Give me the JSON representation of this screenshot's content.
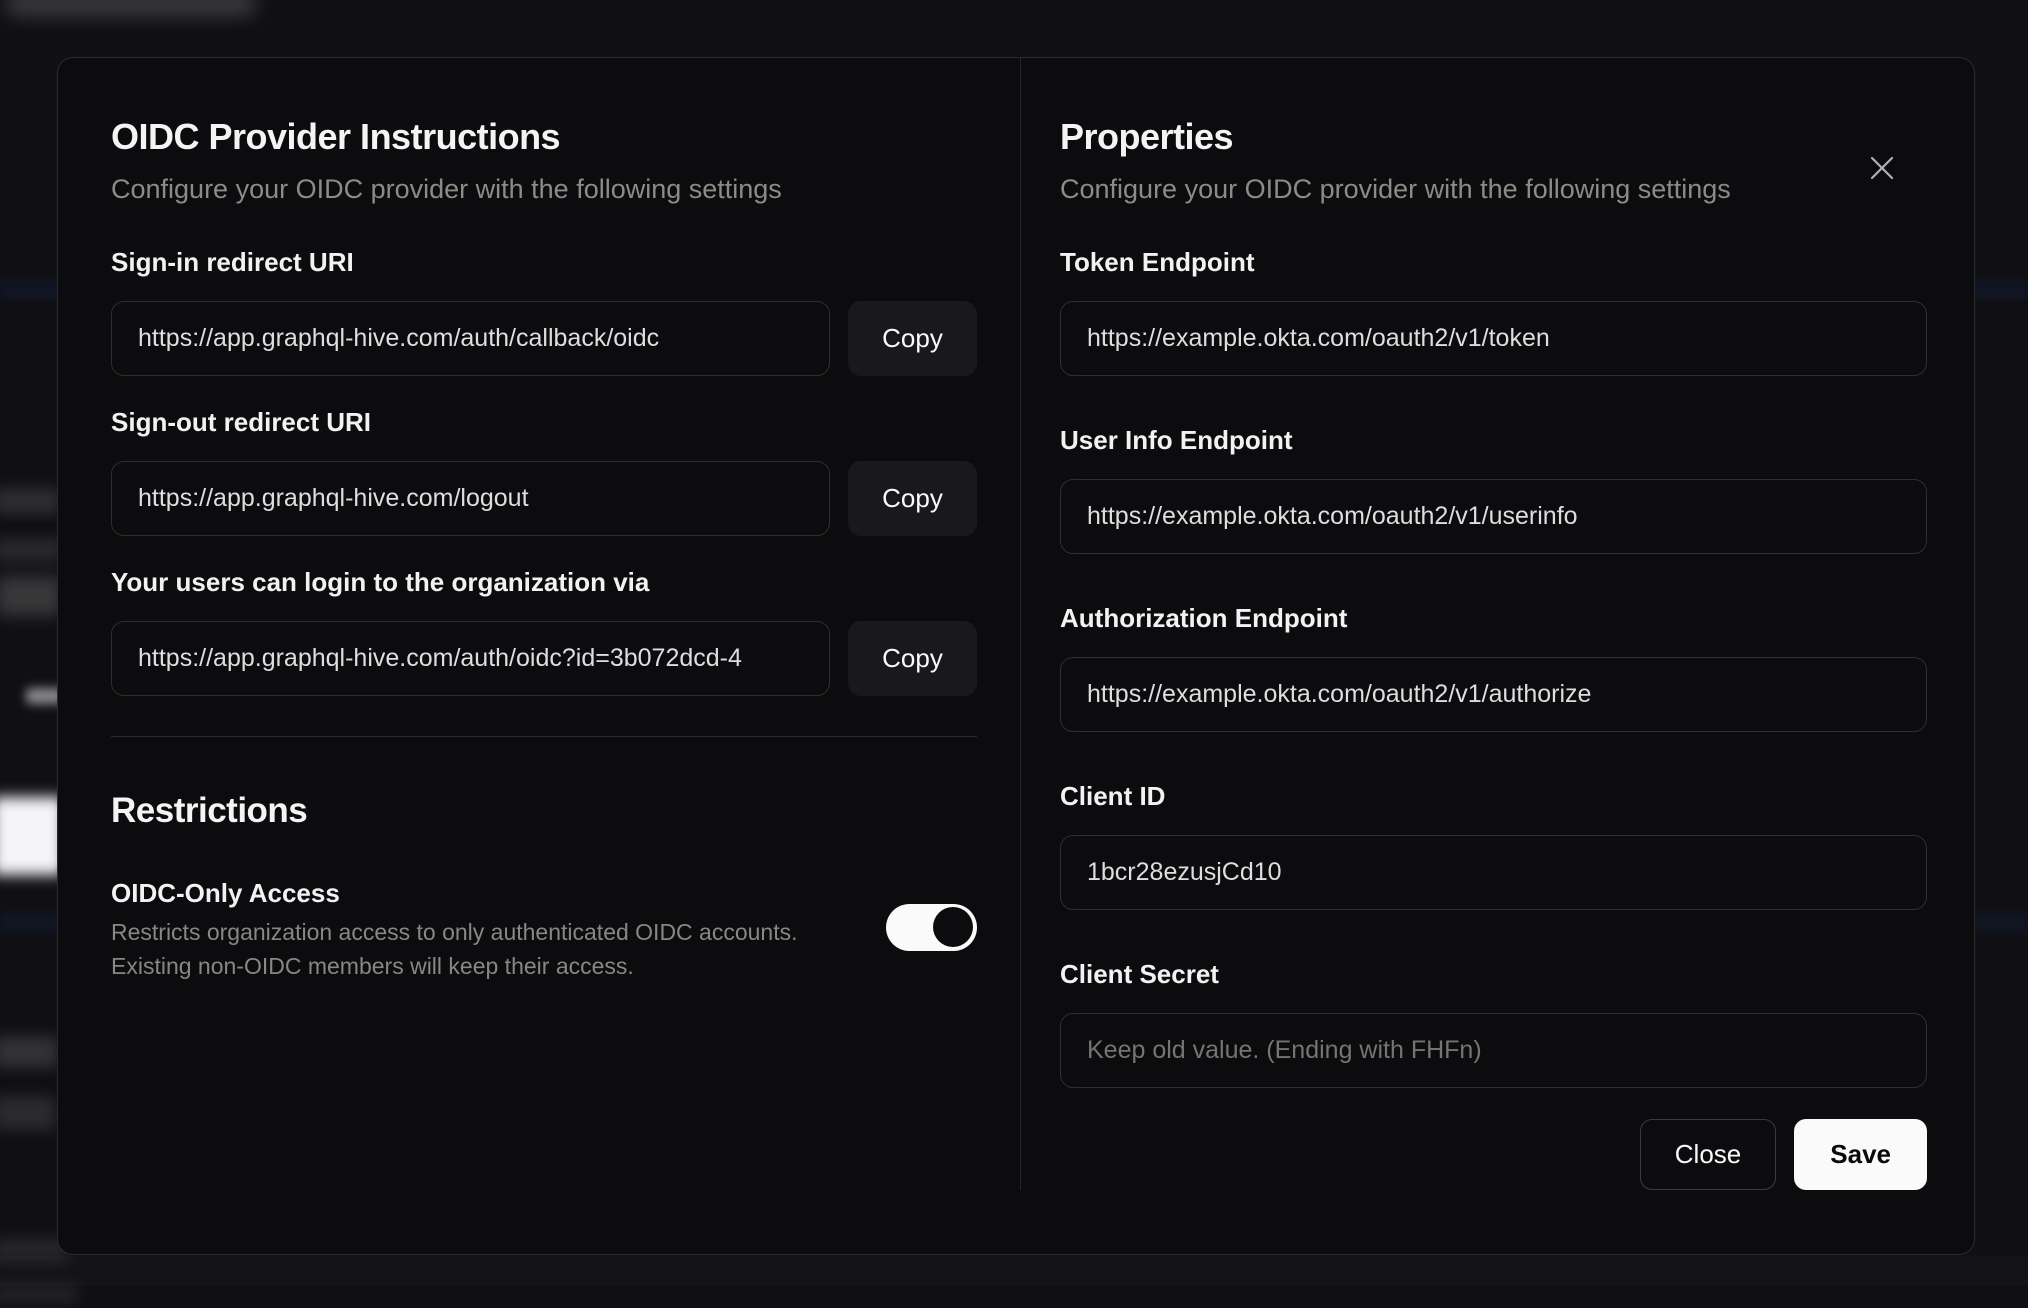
{
  "modal": {
    "left": {
      "title": "OIDC Provider Instructions",
      "subtitle": "Configure your OIDC provider with the following settings",
      "fields": [
        {
          "label": "Sign-in redirect URI",
          "value": "https://app.graphql-hive.com/auth/callback/oidc",
          "copy_label": "Copy"
        },
        {
          "label": "Sign-out redirect URI",
          "value": "https://app.graphql-hive.com/logout",
          "copy_label": "Copy"
        },
        {
          "label": "Your users can login to the organization via",
          "value": "https://app.graphql-hive.com/auth/oidc?id=3b072dcd-4",
          "copy_label": "Copy"
        }
      ],
      "restrictions": {
        "title": "Restrictions",
        "toggle_label": "OIDC-Only Access",
        "toggle_description_line1": "Restricts organization access to only authenticated OIDC accounts.",
        "toggle_description_line2": "Existing non-OIDC members will keep their access.",
        "toggle_state": "on"
      }
    },
    "right": {
      "title": "Properties",
      "subtitle": "Configure your OIDC provider with the following settings",
      "fields": [
        {
          "label": "Token Endpoint",
          "value": "https://example.okta.com/oauth2/v1/token"
        },
        {
          "label": "User Info Endpoint",
          "value": "https://example.okta.com/oauth2/v1/userinfo"
        },
        {
          "label": "Authorization Endpoint",
          "value": "https://example.okta.com/oauth2/v1/authorize"
        },
        {
          "label": "Client ID",
          "value": "1bcr28ezusjCd10"
        },
        {
          "label": "Client Secret",
          "value": "",
          "placeholder": "Keep old value. (Ending with FHFn)"
        }
      ],
      "buttons": {
        "close": "Close",
        "save": "Save"
      }
    },
    "colors": {
      "modal_background": "#0c0c0f",
      "accent_button": "#fafafa",
      "muted_text": "#8e8b86"
    }
  }
}
